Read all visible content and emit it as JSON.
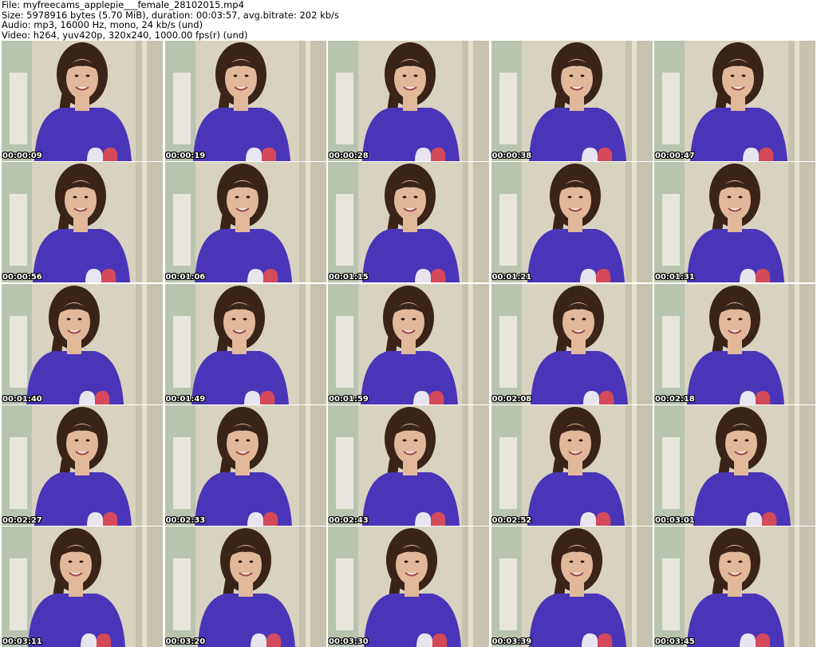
{
  "header": {
    "file_line": "File: myfreecams_applepie___female_28102015.mp4",
    "size_line": "Size: 5978916 bytes (5.70 MiB), duration: 00:03:57, avg.bitrate: 202 kb/s",
    "audio_line": "Audio: mp3, 16000 Hz, mono, 24 kb/s (und)",
    "video_line": "Video: h264, yuv420p, 320x240, 1000.00 fps(r) (und)"
  },
  "colors": {
    "shirt": "#4a35b8",
    "hair": "#3a2418",
    "skin": "#e2b89a",
    "wall": "#d8d2c0",
    "window": "#b8c4b0"
  },
  "thumbnails": [
    {
      "time": "00:00:09"
    },
    {
      "time": "00:00:19"
    },
    {
      "time": "00:00:28"
    },
    {
      "time": "00:00:38"
    },
    {
      "time": "00:00:47"
    },
    {
      "time": "00:00:56"
    },
    {
      "time": "00:01:06"
    },
    {
      "time": "00:01:15"
    },
    {
      "time": "00:01:21"
    },
    {
      "time": "00:01:31"
    },
    {
      "time": "00:01:40"
    },
    {
      "time": "00:01:49"
    },
    {
      "time": "00:01:59"
    },
    {
      "time": "00:02:08"
    },
    {
      "time": "00:02:18"
    },
    {
      "time": "00:02:27"
    },
    {
      "time": "00:02:33"
    },
    {
      "time": "00:02:43"
    },
    {
      "time": "00:02:52"
    },
    {
      "time": "00:03:01"
    },
    {
      "time": "00:03:11"
    },
    {
      "time": "00:03:20"
    },
    {
      "time": "00:03:30"
    },
    {
      "time": "00:03:39"
    },
    {
      "time": "00:03:45"
    }
  ]
}
